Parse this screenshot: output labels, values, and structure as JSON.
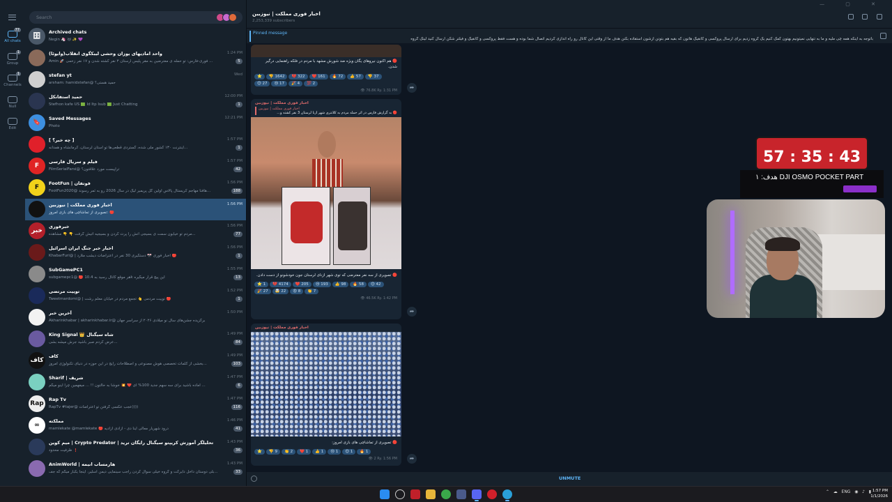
{
  "search": {
    "placeholder": "Search"
  },
  "rail": [
    {
      "label": "All chats",
      "badge": "77",
      "active": true
    },
    {
      "label": "Group",
      "badge": "1"
    },
    {
      "label": "Channels",
      "badge": "1"
    },
    {
      "label": "Null"
    },
    {
      "label": "Edit"
    }
  ],
  "chats": [
    {
      "name": "Archived chats",
      "msg": "Negin 🦄 😻 ✨ 💜",
      "time": "",
      "count": "",
      "color": "#4a5868",
      "initial": "🗄"
    },
    {
      "name": "واحد امادیهای یوزان وحشی لیبکگوی انقلاب(وایوئا)",
      "msg": "Amin 🚀 فوری-فارس: تو حمله ی معترضین به مقر پلیس ارستان ۳ نفر کشته شدن و ۱۷ نفر زخمی ...",
      "time": "1:24 PM",
      "count": "5",
      "color": "#8a6a5a",
      "initial": ""
    },
    {
      "name": "stefan yt",
      "msg": "arsham: hamidstefan@ حمید هستی؟",
      "time": "Wed",
      "count": "",
      "color": "#cfcfcf",
      "initial": ""
    },
    {
      "name": "حمید استفانکل",
      "msg": "Stefhon kafe US 🟩 Id Itp Isub 🟩 Just Chatting",
      "time": "12:00 PM",
      "count": "1",
      "color": "#2a3550",
      "initial": ""
    },
    {
      "name": "Saved Messages",
      "msg": "Photo",
      "time": "12:21 PM",
      "count": "",
      "color": "#3d8fe0",
      "initial": "🔖"
    },
    {
      "name": "[ چه خبر؟ ]",
      "msg": "اینترنت ۱۳۰ کشور ملی شده، گستردی قطعی‌ها تو استان لرستان، کرمانشاه و همدانه...",
      "time": "1:57 PM",
      "count": "1",
      "color": "#e0202a",
      "initial": ""
    },
    {
      "name": "فیلم و سریال فارسی",
      "msg": "FilmSerialFarsi@ تراپیست مورد علاقتون؟",
      "time": "1:57 PM",
      "count": "42",
      "color": "#e02424",
      "initial": "F"
    },
    {
      "name": "FootFun | فوتفان",
      "msg": "FootFun2020@ هافنا مهاجم کریستال پالاس اولین گل پریمیر لیگ در سال 2026 رو به ثمر رسوند...",
      "time": "1:56 PM",
      "count": "188",
      "color": "#f2d21a",
      "initial": "F"
    },
    {
      "name": "اخبار فوری مملکت | نیوزبین",
      "msg": "تصویری از تماشاچی های بازی امروز: 🔴",
      "time": "1:56 PM",
      "count": "",
      "color": "#111",
      "initial": "",
      "selected": true
    },
    {
      "name": "خبرفوری",
      "msg": "مردم تو خیابون سمت ی بسیجی آتش را پرت کردن و بسیجیه آتیش گرفت 👇 👇 مشاهده...",
      "time": "1:56 PM",
      "count": "77",
      "color": "#b3202a",
      "initial": "خبر"
    },
    {
      "name": "اخبار خبر جنگ ایران اسرائیل",
      "msg": "KhabarFuri@ | اخبار فوری 🎌 دستگیری 30 نفر در اعتراضات دیشب ملارد 🔴",
      "time": "1:56 PM",
      "count": "1",
      "color": "#6a1a1a",
      "initial": ""
    },
    {
      "name": "SubGamePC1",
      "msg": "subgamepc1@ 🔴 هر موقع کانال رسید به 10.4k  این پیج قرار میگیره",
      "time": "1:55 PM",
      "count": "13",
      "color": "#8a8a8a",
      "initial": ""
    },
    {
      "name": "توییت مرتضی",
      "msg": "Tweetmardomi@ | توییت مردمی 👆 تجمع مردم در خیابان معلم رشت 🔴",
      "time": "1:52 PM",
      "count": "1",
      "color": "#1a2a5a",
      "initial": ""
    },
    {
      "name": "آخرین خبر",
      "msg": "Akharinkhabar | akharinkhabar.ir@ برگزیده جشن‌های سال نو میلادی ۲۰۲۶ از سراسر جهان",
      "time": "1:50 PM",
      "count": "",
      "color": "#f2f2f2",
      "initial": ""
    },
    {
      "name": "King Signal 👑 شاه سیگنال",
      "msg": "عرض کردم صبر باشید جرش میشه بشی...",
      "time": "1:49 PM",
      "count": "84",
      "color": "#6a5aa0",
      "initial": ""
    },
    {
      "name": "کاف",
      "msg": "بخشی از کلمات تخصصی هوش مصنوعی و اصطلاحات رایج در این حوزه  در دنیای تکنولوژی امروز...",
      "time": "1:49 PM",
      "count": "103",
      "color": "#111",
      "initial": "کاف"
    },
    {
      "name": "Sharif | شریف",
      "msg": "آماده باشید برای سه سهم جدید 100% ای ❤️ 💥 خوشا به حالتون !! ... میفهمین چرا اینو میگم ...",
      "time": "1:47 PM",
      "count": "6",
      "color": "#7ad0c0",
      "initial": ""
    },
    {
      "name": "Rap Tv",
      "msg": "RapTv #tajer@ عجب عکسی گرفتن تو اعتراضات))))",
      "time": "1:47 PM",
      "count": "116",
      "color": "#eee",
      "initial": "Rap"
    },
    {
      "name": "مملکته",
      "msg": "mamlekate @mamlekate 🔴 درود شهریار معالی اینا  دی - آزادی آزادیه",
      "time": "1:46 PM",
      "count": "41",
      "color": "#fff",
      "initial": "∞"
    },
    {
      "name": "میم کوین | Crypto Predator | تحلیلگر آموزش کریپتو سیگنال رایگان ترید",
      "msg": "ظرفیت محدود ❗",
      "time": "1:43 PM",
      "count": "36",
      "color": "#2a3a5a",
      "initial": ""
    },
    {
      "name": "AnimWorld | هارمساب انیمه",
      "msg": "بلی دوستان داخل دایرکت و گروه خیلی سوال کردن راجب سینمایی دیمن اسلیر، اینجا یکبار میگم که جف...",
      "time": "1:43 PM",
      "count": "33",
      "color": "#8a6ab0",
      "initial": ""
    }
  ],
  "header": {
    "title": "اخبار فوری مملکت | نیوزبین",
    "subtitle": "2,253,339 subscribers"
  },
  "pinned": {
    "label": "Pinned message",
    "text": "باتوجه به اینکه همه چی ملیه و ما به تنهایی نمیتونیم بهتون کمک کنیم یک گروه زدیم برای ارسال پروکسی و کانفیگ هاتون که بقیه هم بتونن ازشون استفاده بکنن   هدف ما از وقتی این کانال رو راه اندازی کردیم اتصال شما بوده و هست    فقط پروکسی و کانفیگ و فیلتر شکن ارسال کنید   لینک گروه"
  },
  "posts": [
    {
      "text": "🔴 هم اکنون نیروهای یگان ویژه ضد شورش مشهد با مردم  در فلکه راهنمایی درگیر شدن.",
      "reactions": [
        "⭐",
        "👎 1642",
        "💔 322",
        "❤️ 161",
        "🔥 72",
        "👍 57",
        "👎 37",
        "😊 27",
        "😢 17",
        "🎉 4",
        "💯 2"
      ],
      "meta": "👁 76.8K  Ry. 1:31 PM"
    },
    {
      "source": "اخبار فوری مملکت | نیوزبین",
      "reply": "اخبار فوری مملکت | نیوزبین",
      "intro": "🔴 به گزارش فارس در اثر حمله مردم به کلانتری شهر ازنا لرستان 3 نفر کشته و...",
      "text": "🔴 تصویری از سه نفر معترضی که توی شهر ازنای لرستان جون خودشونو از دست دادن.",
      "reactions": [
        "⭐ 1",
        "💔 4174",
        "❤️ 205",
        "😢 193",
        "👍 98",
        "🔥 58",
        "😊 42",
        "🎉 27",
        "🤯 22",
        "😡 8",
        "👏 7"
      ],
      "meta": "👁 46.5K  Ry. 1:42 PM"
    },
    {
      "source": "اخبار فوری مملکت | نیوزبین",
      "text": "🔴 تصویری از تماشاچی های بازی امروز:",
      "reactions": [
        "⭐",
        "👎 9",
        "👏 2",
        "❤️ 1",
        "👍 1",
        "😢 1",
        "😊 1",
        "🔥 1"
      ],
      "meta": "👁 2  Ry. 1:56 PM"
    }
  ],
  "composer": {
    "unmute": "UNMUTE"
  },
  "overlay": {
    "timer": "57 : 35 : 43",
    "goal": "هدف: ۱ DJI OSMO POCKET PART"
  },
  "taskbar": {
    "lang": "ENG",
    "time": "1:57 PM",
    "date": "1/1/2026"
  }
}
